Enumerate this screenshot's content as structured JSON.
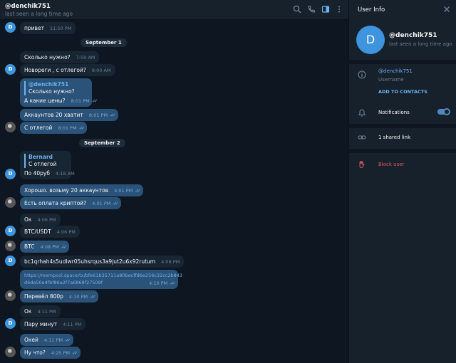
{
  "header": {
    "title": "@denchik751",
    "status": "last seen a long time ago"
  },
  "messages": [
    {
      "avatar": "D",
      "text": "привет",
      "time": "11:50 PM"
    },
    {
      "text": "Сколько нужно?",
      "time": "7:59 AM"
    },
    {
      "avatar": "D",
      "text": "Новореги , с отлегой?",
      "time": "8:00 AM"
    },
    {
      "text": "Аккаунтов 20 хватит",
      "time": "8:01 PM"
    },
    {
      "text": "С отлегой",
      "time": "8:01 PM"
    },
    {
      "text": "Хорошо. возьму 20 аккаунтов",
      "time": "4:01 PM"
    },
    {
      "text": "Есть оплата криптой?",
      "time": "4:01 PM"
    },
    {
      "text": "Ок",
      "time": "4:06 PM"
    },
    {
      "avatar": "D",
      "text": "BTC/USDT",
      "time": "4:06 PM"
    },
    {
      "text": "BTC",
      "time": "4:08 PM"
    },
    {
      "avatar": "D",
      "text": "bc1qrhah4s5udlwr05uhsrqus3a9jut2u6x92rutum",
      "time": "4:08 PM"
    },
    {
      "text": "Перевёл 800р",
      "time": "4:10 PM"
    },
    {
      "text": "Ок",
      "time": "4:11 PM"
    },
    {
      "avatar": "D",
      "text": "Пару минут",
      "time": "4:11 PM"
    },
    {
      "text": "Окей",
      "time": "4:11 PM"
    },
    {
      "text": "Ну что?",
      "time": "4:25 PM"
    }
  ],
  "replies": [
    {
      "quote_name": "@denchik751",
      "quote_text": "Сколько нужно?",
      "text": "А какие цены?",
      "time": "8:01 PM"
    },
    {
      "quote_name": "Bernard",
      "quote_text": "С отлегой",
      "text": "По 40руб",
      "time": "4:18 AM",
      "avatar": "D"
    }
  ],
  "link_message": {
    "line1": "https://mempool.space/tx/bfe61b35711a80becffd6e256c32cc2b843",
    "line2": "d6da50e4fbf86a2f7a6868f27509f",
    "time": "4:10 PM"
  },
  "dates": [
    "September 1",
    "September 2"
  ],
  "info": {
    "title": "User Info",
    "avatar_letter": "D",
    "name": "@denchik751",
    "seen": "last seen a long time ago",
    "username": "@denchik751",
    "username_label": "Username",
    "add_contacts": "ADD TO CONTACTS",
    "notifications": "Notifications",
    "notifications_on": true,
    "shared_link": "1 shared link",
    "block": "Block user"
  },
  "colors": {
    "accent": "#6ab2f2",
    "outgoing": "#2b5278",
    "incoming": "#182533",
    "danger": "#e05562",
    "avatar": "#3e95dd"
  },
  "icons": [
    "search-icon",
    "phone-icon",
    "sidebar-icon",
    "more-icon",
    "close-icon",
    "info-icon",
    "bell-icon",
    "link-icon",
    "block-hand-icon"
  ]
}
